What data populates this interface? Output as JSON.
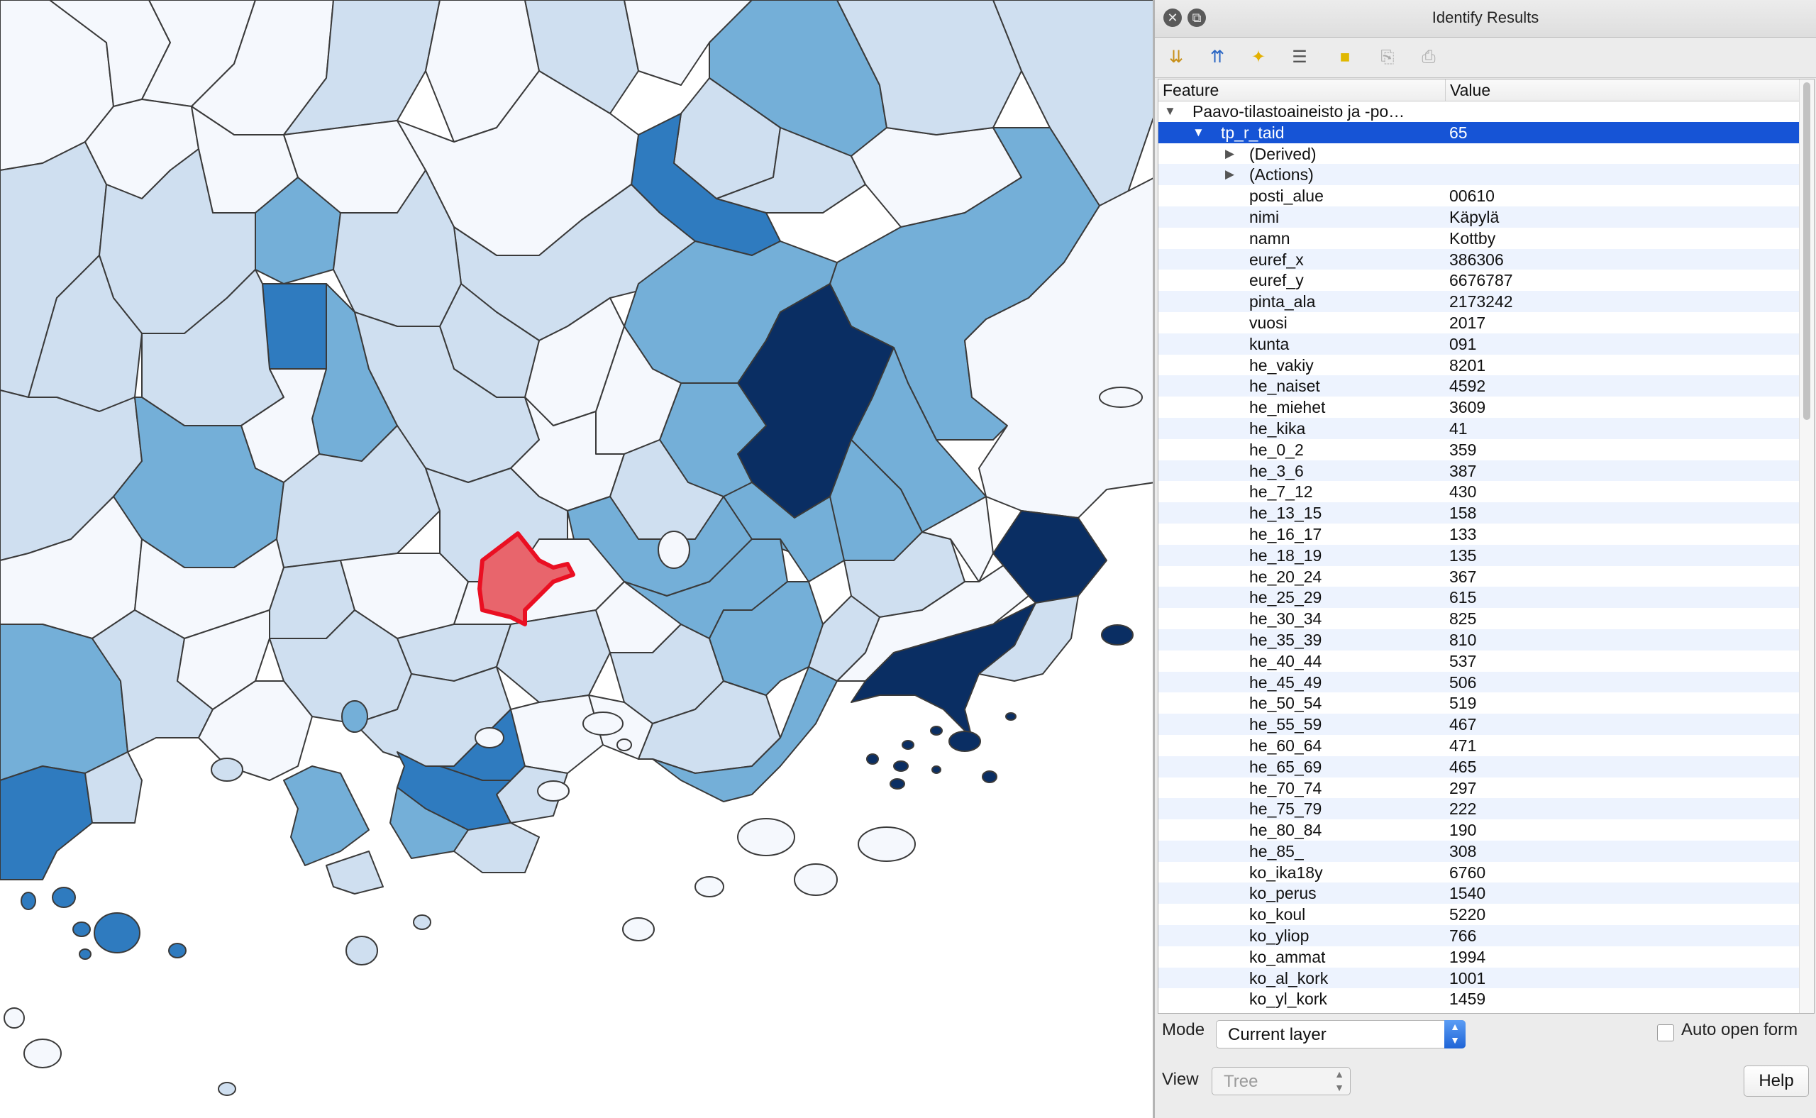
{
  "window": {
    "title": "Identify Results"
  },
  "toolbar": {
    "icons": [
      "expand-tree-icon",
      "collapse-tree-icon",
      "expand-new-results-icon",
      "open-form-icon",
      "clear-results-icon",
      "copy-feature-icon",
      "print-icon"
    ]
  },
  "table": {
    "col_feature": "Feature",
    "col_value": "Value",
    "layer": "Paavo-tilastoaineisto ja -po…",
    "feature_name": "tp_r_taid",
    "feature_id": "65",
    "derived": "(Derived)",
    "actions": "(Actions)",
    "attributes": [
      {
        "field": "posti_alue",
        "value": "00610"
      },
      {
        "field": "nimi",
        "value": "Käpylä"
      },
      {
        "field": "namn",
        "value": "Kottby"
      },
      {
        "field": "euref_x",
        "value": "386306"
      },
      {
        "field": "euref_y",
        "value": "6676787"
      },
      {
        "field": "pinta_ala",
        "value": "2173242"
      },
      {
        "field": "vuosi",
        "value": "2017"
      },
      {
        "field": "kunta",
        "value": "091"
      },
      {
        "field": "he_vakiy",
        "value": "8201"
      },
      {
        "field": "he_naiset",
        "value": "4592"
      },
      {
        "field": "he_miehet",
        "value": "3609"
      },
      {
        "field": "he_kika",
        "value": "41"
      },
      {
        "field": "he_0_2",
        "value": "359"
      },
      {
        "field": "he_3_6",
        "value": "387"
      },
      {
        "field": "he_7_12",
        "value": "430"
      },
      {
        "field": "he_13_15",
        "value": "158"
      },
      {
        "field": "he_16_17",
        "value": "133"
      },
      {
        "field": "he_18_19",
        "value": "135"
      },
      {
        "field": "he_20_24",
        "value": "367"
      },
      {
        "field": "he_25_29",
        "value": "615"
      },
      {
        "field": "he_30_34",
        "value": "825"
      },
      {
        "field": "he_35_39",
        "value": "810"
      },
      {
        "field": "he_40_44",
        "value": "537"
      },
      {
        "field": "he_45_49",
        "value": "506"
      },
      {
        "field": "he_50_54",
        "value": "519"
      },
      {
        "field": "he_55_59",
        "value": "467"
      },
      {
        "field": "he_60_64",
        "value": "471"
      },
      {
        "field": "he_65_69",
        "value": "465"
      },
      {
        "field": "he_70_74",
        "value": "297"
      },
      {
        "field": "he_75_79",
        "value": "222"
      },
      {
        "field": "he_80_84",
        "value": "190"
      },
      {
        "field": "he_85_",
        "value": "308"
      },
      {
        "field": "ko_ika18y",
        "value": "6760"
      },
      {
        "field": "ko_perus",
        "value": "1540"
      },
      {
        "field": "ko_koul",
        "value": "5220"
      },
      {
        "field": "ko_yliop",
        "value": "766"
      },
      {
        "field": "ko_ammat",
        "value": "1994"
      },
      {
        "field": "ko_al_kork",
        "value": "1001"
      },
      {
        "field": "ko_yl_kork",
        "value": "1459"
      }
    ]
  },
  "controls": {
    "mode_label": "Mode",
    "mode_value": "Current layer",
    "auto_open_label": "Auto open form",
    "auto_open_checked": false,
    "view_label": "View",
    "view_value": "Tree",
    "help_label": "Help"
  },
  "map": {
    "colors": {
      "lightest": "#f5f8fd",
      "light": "#cfdff0",
      "medium": "#74afd8",
      "dark": "#2f7bbf",
      "darkest": "#0a2e63",
      "selected": "#e8656c",
      "selected_outline": "#ea0f22"
    }
  }
}
